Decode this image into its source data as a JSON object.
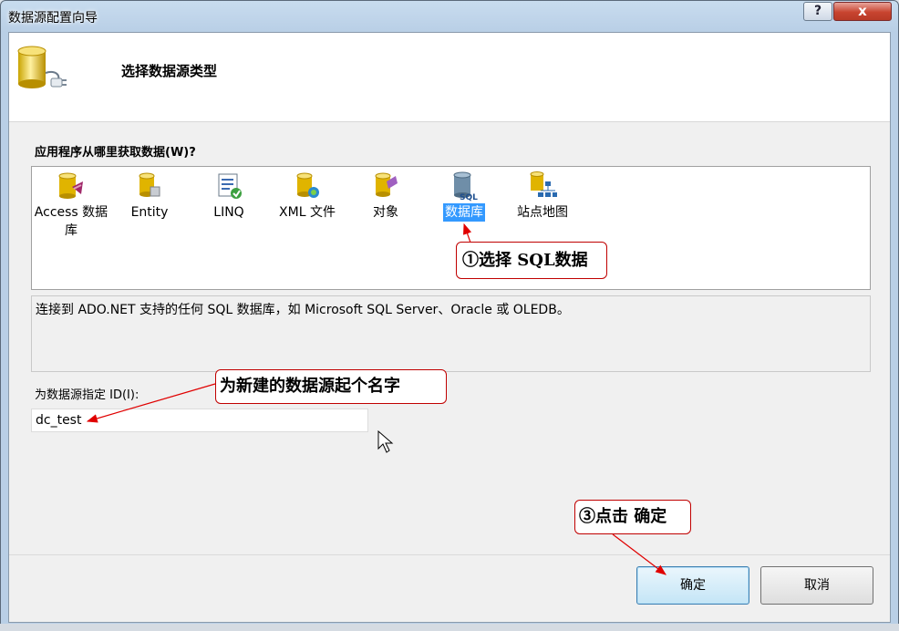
{
  "window": {
    "title": "数据源配置向导",
    "help_label": "?",
    "close_label": "x"
  },
  "header": {
    "title": "选择数据源类型",
    "icon": "database-plug-icon"
  },
  "prompt": "应用程序从哪里获取数据(W)?",
  "data_types": [
    {
      "label": "Access 数据库",
      "icon": "access-database-icon",
      "selected": false
    },
    {
      "label": "Entity",
      "icon": "entity-icon",
      "selected": false
    },
    {
      "label": "LINQ",
      "icon": "linq-icon",
      "selected": false
    },
    {
      "label": "XML 文件",
      "icon": "xml-file-icon",
      "selected": false
    },
    {
      "label": "对象",
      "icon": "object-icon",
      "selected": false
    },
    {
      "label": "数据库",
      "icon": "sql-database-icon",
      "selected": true
    },
    {
      "label": "站点地图",
      "icon": "sitemap-icon",
      "selected": false
    }
  ],
  "description": "连接到 ADO.NET 支持的任何 SQL 数据库，如 Microsoft SQL Server、Oracle 或 OLEDB。",
  "id_field": {
    "label": "为数据源指定 ID(I):",
    "value": "dc_test"
  },
  "buttons": {
    "ok": "确定",
    "cancel": "取消"
  },
  "annotations": {
    "step1": "①选择 SQL数据",
    "name_hint": "为新建的数据源起个名字",
    "step3": "③点击 确定"
  },
  "colors": {
    "selection": "#3399ff",
    "callout_border": "#c00000",
    "arrow": "#e00000"
  }
}
